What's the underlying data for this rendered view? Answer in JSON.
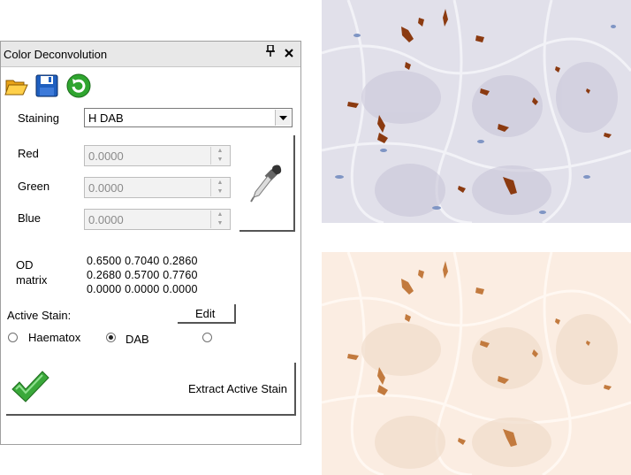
{
  "window": {
    "title": "Color Deconvolution",
    "pin_symbol": "📌",
    "close_symbol": "✕"
  },
  "toolbar": {
    "open_icon": "folder-open-icon",
    "save_icon": "floppy-save-icon",
    "refresh_icon": "refresh-icon"
  },
  "staining": {
    "label": "Staining",
    "selected": "H DAB"
  },
  "rgb": {
    "red_label": "Red",
    "red_value": "0.0000",
    "green_label": "Green",
    "green_value": "0.0000",
    "blue_label": "Blue",
    "blue_value": "0.0000",
    "spin_up": "▲",
    "spin_down": "▼"
  },
  "od_matrix": {
    "label_line1": "OD",
    "label_line2": "matrix",
    "rows": [
      "0.6500  0.7040  0.2860",
      "0.2680  0.5700  0.7760",
      "0.0000  0.0000  0.0000"
    ]
  },
  "active_stain": {
    "label": "Active Stain:",
    "edit_label": "Edit",
    "options": [
      "Haematox",
      "DAB",
      ""
    ],
    "selected_index": 1
  },
  "extract": {
    "label": "Extract Active Stain"
  },
  "colors": {
    "dab_brown": "#8b3a10",
    "hematoxylin_blue": "#6f87b8",
    "check_green": "#3aa83a"
  },
  "images": {
    "top": "original-he-dab-tissue-image",
    "bottom": "dab-channel-tissue-image"
  }
}
